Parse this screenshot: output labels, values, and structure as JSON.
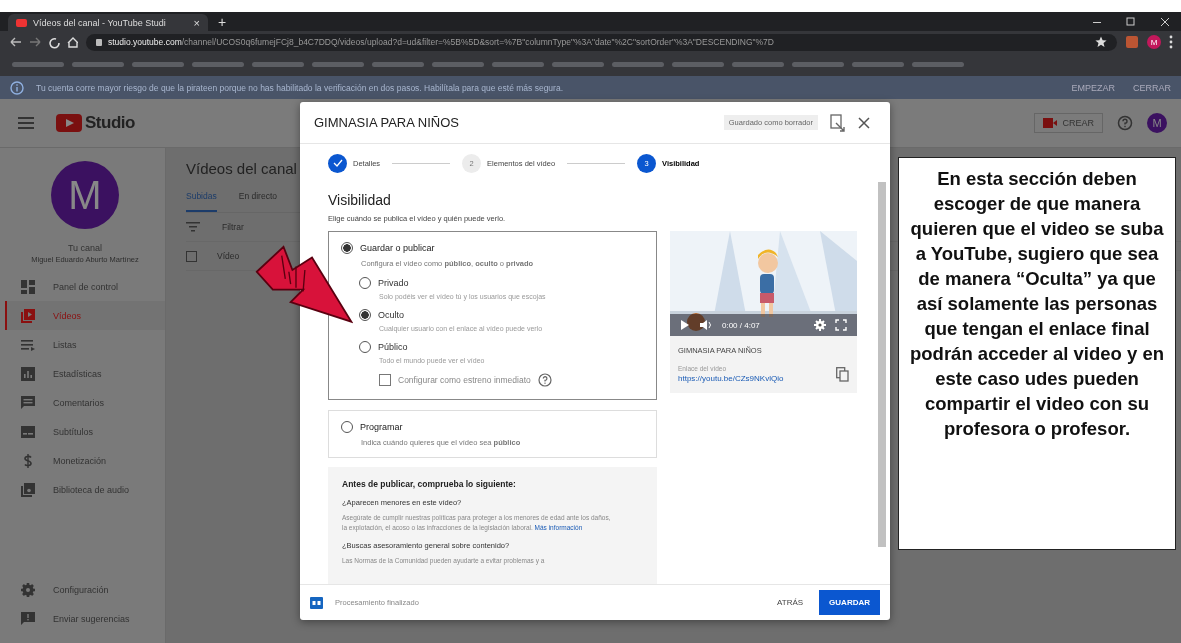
{
  "browser": {
    "tab_title": "Vídeos del canal - YouTube Studi",
    "tab_close": "×",
    "new_tab": "+",
    "url_host": "studio.youtube.com",
    "url_path": "/channel/UCOS0q6fumejFCj8_b4C7DDQ/videos/upload?d=ud&filter=%5B%5D&sort=%7B\"columnType\"%3A\"date\"%2C\"sortOrder\"%3A\"DESCENDING\"%7D",
    "profile": "M"
  },
  "warning": {
    "text": "Tu cuenta corre mayor riesgo de que la pirateen porque no has habilitado la verificación en dos pasos. Habilítala para que esté más segura.",
    "actions": [
      "EMPEZAR",
      "CERRAR"
    ]
  },
  "header": {
    "logo": "Studio",
    "create": "CREAR",
    "avatar": "M"
  },
  "sidebar": {
    "avatar": "M",
    "channel_label": "Tu canal",
    "channel_name": "Miguel Eduardo Aburto Martínez",
    "items": [
      {
        "label": "Panel de control",
        "selected": false
      },
      {
        "label": "Vídeos",
        "selected": true
      },
      {
        "label": "Listas",
        "selected": false
      },
      {
        "label": "Estadísticas",
        "selected": false
      },
      {
        "label": "Comentarios",
        "selected": false
      },
      {
        "label": "Subtítulos",
        "selected": false
      },
      {
        "label": "Monetización",
        "selected": false
      },
      {
        "label": "Biblioteca de audio",
        "selected": false
      }
    ],
    "footer_items": [
      {
        "label": "Configuración"
      },
      {
        "label": "Enviar sugerencias"
      }
    ]
  },
  "content": {
    "title": "Vídeos del canal",
    "tabs": [
      {
        "label": "Subidas",
        "selected": true
      },
      {
        "label": "En directo",
        "selected": false
      }
    ],
    "filter_placeholder": "Filtrar",
    "column": "Vídeo",
    "select_all_checked": false
  },
  "dialog": {
    "title": "GIMNASIA PARA NIÑOS",
    "draft_badge": "Guardado como borrador",
    "steps": [
      {
        "label": "Detalles",
        "completed": true,
        "selected": false
      },
      {
        "label": "Elementos del vídeo",
        "number": "2",
        "completed": false,
        "selected": false
      },
      {
        "label": "Visibilidad",
        "number": "3",
        "completed": false,
        "selected": true
      }
    ],
    "heading": "Visibilidad",
    "subheading": "Elige cuándo se publica el vídeo y quién puede verlo.",
    "save_option": {
      "label": "Guardar o publicar",
      "description": "Configura el vídeo como **público**, **oculto** o **privado**",
      "selected": true,
      "options": [
        {
          "label": "Privado",
          "description": "Solo podéis ver el vídeo tú y los usuarios que escojas",
          "selected": false
        },
        {
          "label": "Oculto",
          "description": "Cualquier usuario con el enlace al vídeo puede verlo",
          "selected": true
        },
        {
          "label": "Público",
          "description": "Todo el mundo puede ver el vídeo",
          "selected": false
        }
      ],
      "premiere": {
        "label": "Configurar como estreno inmediato",
        "checked": false
      }
    },
    "schedule_option": {
      "label": "Programar",
      "description": "Indica cuándo quieres que el vídeo sea **público**",
      "selected": false
    },
    "checklist": {
      "title": "Antes de publicar, comprueba lo siguiente:",
      "q1": "¿Aparecen menores en este vídeo?",
      "a1": "Asegúrate de cumplir nuestras políticas para proteger a los menores de edad ante los daños, la explotación, el acoso o las infracciones de la legislación laboral.",
      "a1_link": "Más información",
      "q2": "¿Buscas asesoramiento general sobre contenido?",
      "a2": "Las Normas de la Comunidad pueden ayudarte a evitar problemas y a"
    },
    "preview": {
      "player_time": "0:00 / 4:07",
      "video_title": "GIMNASIA PARA NIÑOS",
      "link_label": "Enlace del vídeo",
      "link": "https://youtu.be/CZs9NKvlQio"
    },
    "status": "Procesamiento finalizado",
    "buttons": [
      {
        "label": "ATRÁS",
        "kind": "text"
      },
      {
        "label": "GUARDAR",
        "kind": "primary"
      }
    ]
  },
  "annotation": "En esta sección deben escoger de que manera quieren que el video se suba a YouTube, sugiero que sea de manera “Oculta” ya que así solamente las personas que tengan el enlace final podrán acceder al video y en este caso udes pueden compartir el video con su profesora o profesor."
}
